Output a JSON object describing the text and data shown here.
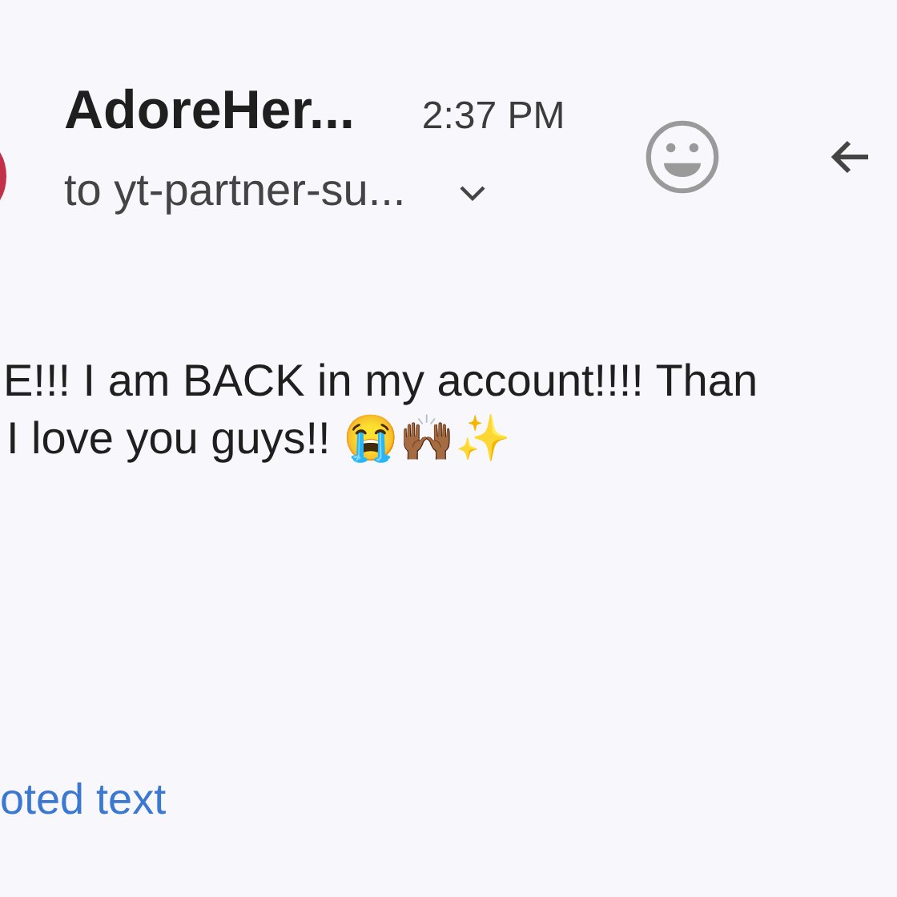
{
  "header": {
    "sender": "AdoreHer...",
    "time": "2:37 PM",
    "recipient": "to yt-partner-su..."
  },
  "body": {
    "lines": [
      "E!!! I am BACK in my account!!!! Than",
      "I love you guys!! 😭🙌🏾✨"
    ]
  },
  "quoted_link": "oted text"
}
